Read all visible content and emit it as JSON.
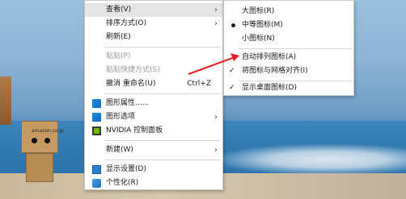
{
  "context_menu": {
    "items": [
      {
        "label": "查看(V)",
        "submenu": true
      },
      {
        "label": "排序方式(O)",
        "submenu": true
      },
      {
        "label": "刷新(E)"
      },
      {
        "label": "粘贴(P)",
        "disabled": true
      },
      {
        "label": "粘贴快捷方式(S)",
        "disabled": true
      },
      {
        "label": "撤消 重命名(U)",
        "shortcut": "Ctrl+Z"
      },
      {
        "label": "图形属性......",
        "icon": "intel-graphics-icon"
      },
      {
        "label": "图形选项",
        "icon": "intel-graphics-icon",
        "submenu": true
      },
      {
        "label": "NVIDIA 控制面板",
        "icon": "nvidia-icon"
      },
      {
        "label": "新建(W)",
        "submenu": true
      },
      {
        "label": "显示设置(D)",
        "icon": "display-settings-icon"
      },
      {
        "label": "个性化(R)",
        "icon": "personalize-icon"
      }
    ]
  },
  "view_submenu": {
    "items": [
      {
        "label": "大图标(R)"
      },
      {
        "label": "中等图标(M)",
        "mark": "dot"
      },
      {
        "label": "小图标(N)"
      },
      {
        "label": "自动排列图标(A)",
        "highlighted": true
      },
      {
        "label": "将图标与网格对齐(I)",
        "mark": "check"
      },
      {
        "label": "显示桌面图标(D)",
        "mark": "check"
      }
    ]
  },
  "glyphs": {
    "submenu_arrow": "›",
    "check": "✓"
  },
  "annotation": {
    "color": "#e8232a"
  },
  "desktop": {
    "figure_logo": "amazon.co.jp"
  }
}
